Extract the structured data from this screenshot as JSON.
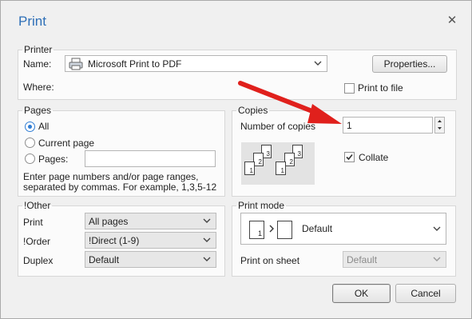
{
  "dialog": {
    "title": "Print",
    "close_glyph": "✕"
  },
  "printer": {
    "legend": "Printer",
    "name_label": "Name:",
    "name_value": "Microsoft Print to PDF",
    "where_label": "Where:",
    "properties_label": "Properties...",
    "print_to_file_label": "Print to file"
  },
  "pages": {
    "legend": "Pages",
    "all_label": "All",
    "current_page_label": "Current page",
    "pages_label": "Pages:",
    "pages_value": "",
    "hint_line1": "Enter page numbers and/or page ranges,",
    "hint_line2": "separated by commas. For example, 1,3,5-12"
  },
  "copies": {
    "legend": "Copies",
    "number_label": "Number of copies",
    "number_value": "1",
    "collate_label": "Collate",
    "collate_checked": true,
    "collate_page_numbers": [
      "1",
      "2",
      "3"
    ]
  },
  "other": {
    "legend": "!Other",
    "print_label": "Print",
    "print_value": "All pages",
    "order_label": "!Order",
    "order_value": "!Direct (1-9)",
    "duplex_label": "Duplex",
    "duplex_value": "Default"
  },
  "print_mode": {
    "legend": "Print mode",
    "mode_value": "Default",
    "mode_page_number": "1",
    "on_sheet_label": "Print on sheet",
    "on_sheet_value": "Default"
  },
  "buttons": {
    "ok_label": "OK",
    "cancel_label": "Cancel"
  },
  "annotation": {
    "arrow_color": "#e0201c"
  }
}
